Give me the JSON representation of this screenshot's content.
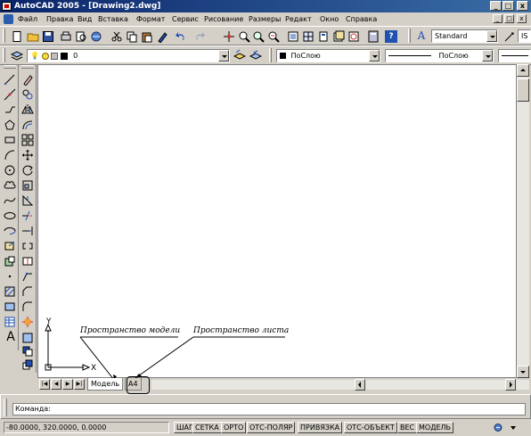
{
  "window": {
    "title": "AutoCAD 2005 - [Drawing2.dwg]",
    "minimize_glyph": "_",
    "maximize_glyph": "□",
    "close_glyph": "x"
  },
  "menu": {
    "items": [
      "Файл",
      "Правка",
      "Вид",
      "Вставка",
      "Формат",
      "Сервис",
      "Рисование",
      "Размеры",
      "Редакт",
      "Окно",
      "Справка"
    ]
  },
  "toolbar": {
    "text_style": "Standard",
    "text_style_2": "IS",
    "layer": "0",
    "color": "ПоСлою",
    "linetype": "ПоСлою",
    "help_glyph": "?",
    "text_style_icon_glyph": "A"
  },
  "canvas": {
    "ucs_x_label": "X",
    "ucs_y_label": "Y"
  },
  "tabs": {
    "model": "Модель",
    "layout": "A4"
  },
  "annotations": {
    "model_space": "Пространство модели",
    "paper_space": "Пространство листа"
  },
  "command": {
    "prompt": "Команда:"
  },
  "status": {
    "coordinates": "-80.0000, 320.0000, 0.0000",
    "buttons": [
      "ШАГ",
      "СЕТКА",
      "ОРТО",
      "ОТС-ПОЛЯР",
      "ПРИВЯЗКА",
      "ОТС-ОБЪЕКТ",
      "ВЕС",
      "МОДЕЛЬ"
    ]
  },
  "draw_toolbar_icons": [
    "line-icon",
    "construction-line-icon",
    "polyline-icon",
    "polygon-icon",
    "rectangle-icon",
    "arc-icon",
    "circle-icon",
    "revision-cloud-icon",
    "spline-icon",
    "ellipse-icon",
    "ellipse-arc-icon",
    "insert-block-icon",
    "make-block-icon",
    "point-icon",
    "hatch-icon",
    "region-icon",
    "table-icon",
    "multiline-text-icon"
  ],
  "modify_toolbar_icons": [
    "erase-icon",
    "copy-icon",
    "mirror-icon",
    "offset-icon",
    "array-icon",
    "move-icon",
    "rotate-icon",
    "scale-icon",
    "stretch-icon",
    "trim-icon",
    "extend-icon",
    "break-icon",
    "break-at-point-icon",
    "join-icon",
    "chamfer-icon",
    "fillet-icon",
    "explode-icon"
  ],
  "colors": {
    "titlebar_start": "#0a246a",
    "titlebar_end": "#3a6ea5",
    "face": "#d4d0c8"
  }
}
